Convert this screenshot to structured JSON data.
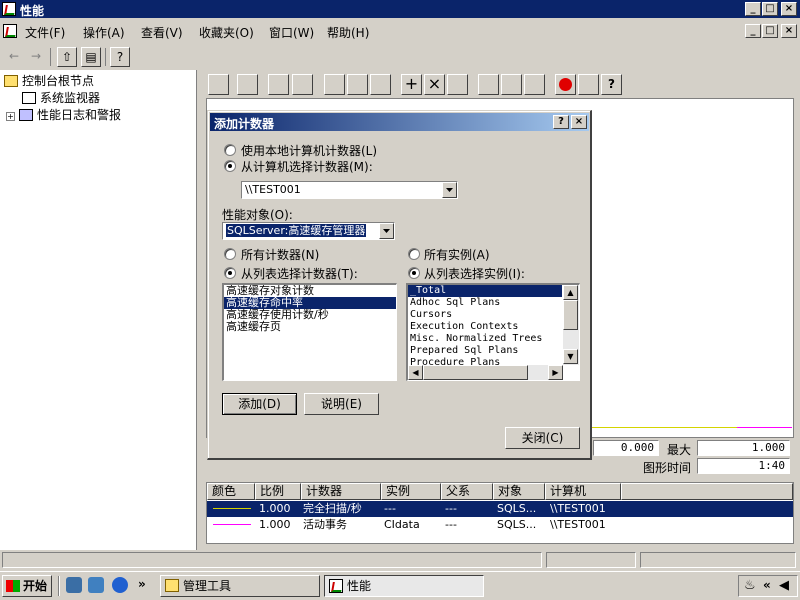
{
  "window": {
    "title": "性能"
  },
  "menu": [
    "文件(F)",
    "操作(A)",
    "查看(V)",
    "收藏夹(O)",
    "窗口(W)",
    "帮助(H)"
  ],
  "tree": {
    "root": "控制台根节点",
    "items": [
      "系统监视器",
      "性能日志和警报"
    ]
  },
  "stats": {
    "min_value": "0.000",
    "max_label": "最大",
    "max_value": "1.000",
    "duration_label": "图形时间",
    "duration_value": "1:40"
  },
  "legend": {
    "headers": [
      "颜色",
      "比例",
      "计数器",
      "实例",
      "父系",
      "对象",
      "计算机"
    ],
    "rows": [
      {
        "color": "#d4d400",
        "scale": "1.000",
        "counter": "完全扫描/秒",
        "instance": "---",
        "parent": "---",
        "object": "SQLS...",
        "computer": "\\\\TEST001"
      },
      {
        "color": "#ff00ff",
        "scale": "1.000",
        "counter": "活动事务",
        "instance": "CIdata",
        "parent": "---",
        "object": "SQLS...",
        "computer": "\\\\TEST001"
      }
    ]
  },
  "dialog": {
    "title": "添加计数器",
    "radio_local": "使用本地计算机计数器(L)",
    "radio_select_computer": "从计算机选择计数器(M):",
    "computer_value": "\\\\TEST001",
    "object_label": "性能对象(O):",
    "object_value": "SQLServer:高速缓存管理器",
    "radio_all_counters": "所有计数器(N)",
    "radio_select_counters": "从列表选择计数器(T):",
    "radio_all_instances": "所有实例(A)",
    "radio_select_instances": "从列表选择实例(I):",
    "counters": [
      "高速缓存对象计数",
      "高速缓存命中率",
      "高速缓存使用计数/秒",
      "高速缓存页"
    ],
    "selected_counter": "高速缓存命中率",
    "instances": [
      "_Total",
      "Adhoc Sql Plans",
      "Cursors",
      "Execution Contexts",
      "Misc. Normalized Trees",
      "Prepared Sql Plans",
      "Procedure Plans"
    ],
    "selected_instance": "_Total",
    "add_button": "添加(D)",
    "explain_button": "说明(E)",
    "close_button": "关闭(C)"
  },
  "taskbar": {
    "start": "开始",
    "tasks": [
      "管理工具",
      "性能"
    ]
  }
}
